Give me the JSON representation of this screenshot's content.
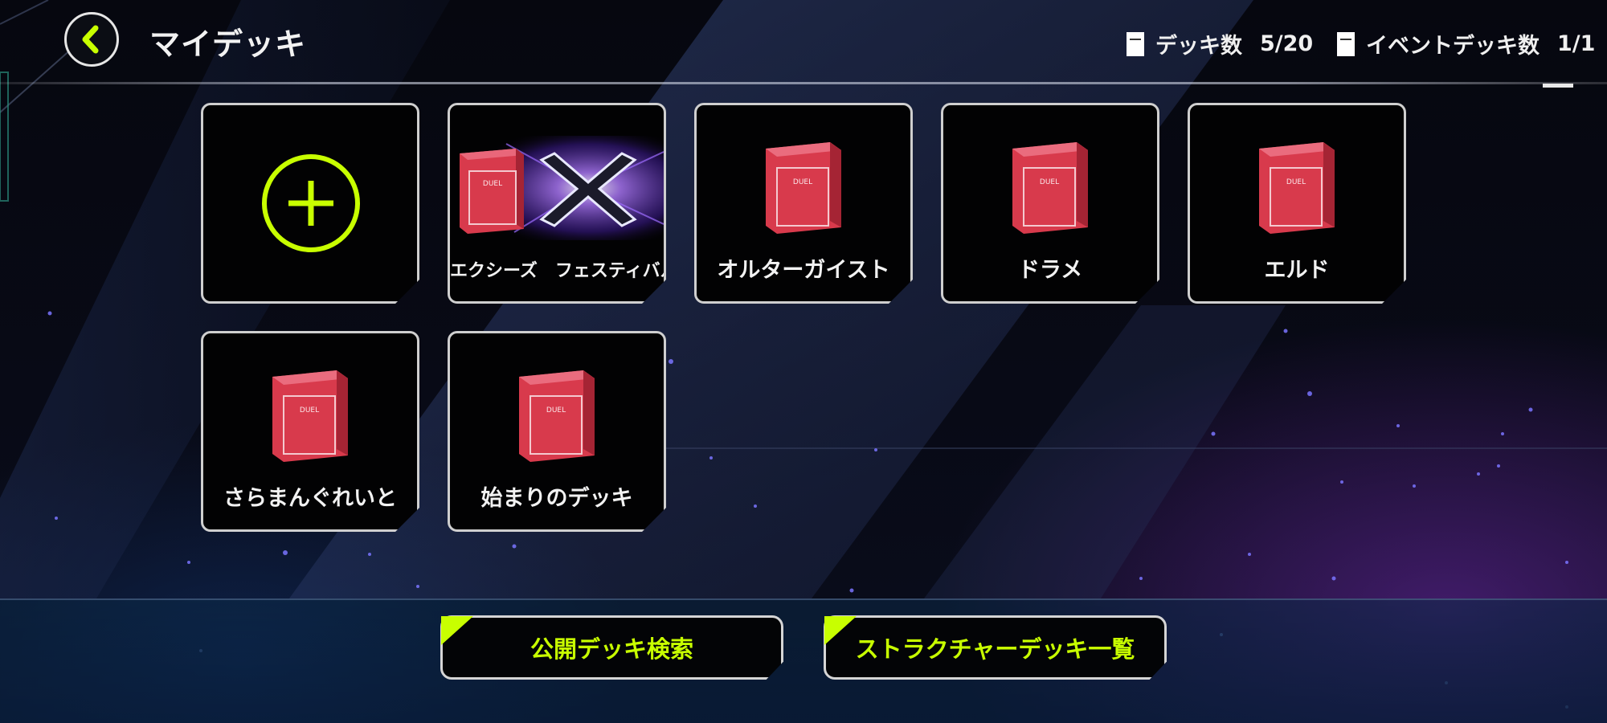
{
  "header": {
    "title": "マイデッキ",
    "deck_count_label": "デッキ数",
    "deck_count_value": "5/20",
    "event_deck_count_label": "イベントデッキ数",
    "event_deck_count_value": "1/1"
  },
  "decks": [
    {
      "label": "エクシーズ　フェスティバル",
      "art": "xyz-festival-art"
    },
    {
      "label": "オルターガイスト",
      "art": "deck-box"
    },
    {
      "label": "ドラメ",
      "art": "deck-box"
    },
    {
      "label": "エルド",
      "art": "deck-box"
    },
    {
      "label": "さらまんぐれいと",
      "art": "deck-box"
    },
    {
      "label": "始まりのデッキ",
      "art": "deck-box"
    }
  ],
  "actions": {
    "public_search": "公開デッキ検索",
    "structure_list": "ストラクチャーデッキ一覧"
  },
  "colors": {
    "accent": "#c8ff00",
    "deck_box": "#d83a4c",
    "tile_border": "#cfcfcf"
  },
  "icons": {
    "back": "chevron-left-icon",
    "add": "plus-circle-icon",
    "deck": "deck-box-icon"
  }
}
